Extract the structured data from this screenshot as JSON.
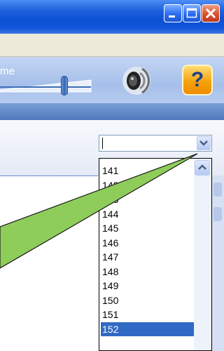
{
  "toolbar": {
    "volume_label": "me",
    "help_label": "?"
  },
  "combo": {
    "value": ""
  },
  "dropdown": {
    "items": [
      "141",
      "142",
      "143",
      "144",
      "145",
      "146",
      "147",
      "148",
      "149",
      "150",
      "151",
      "152"
    ],
    "selected_index": 11
  },
  "volume": {
    "level": 0.66
  },
  "colors": {
    "titlebar": "#0b4fd4",
    "selection": "#316ac5",
    "callout": "#8ecd5a",
    "help_button": "#f5a30c"
  },
  "icons": [
    "minimize-icon",
    "maximize-icon",
    "close-icon",
    "speaker-icon",
    "help-icon",
    "chevron-down-icon",
    "scroll-up-icon"
  ]
}
